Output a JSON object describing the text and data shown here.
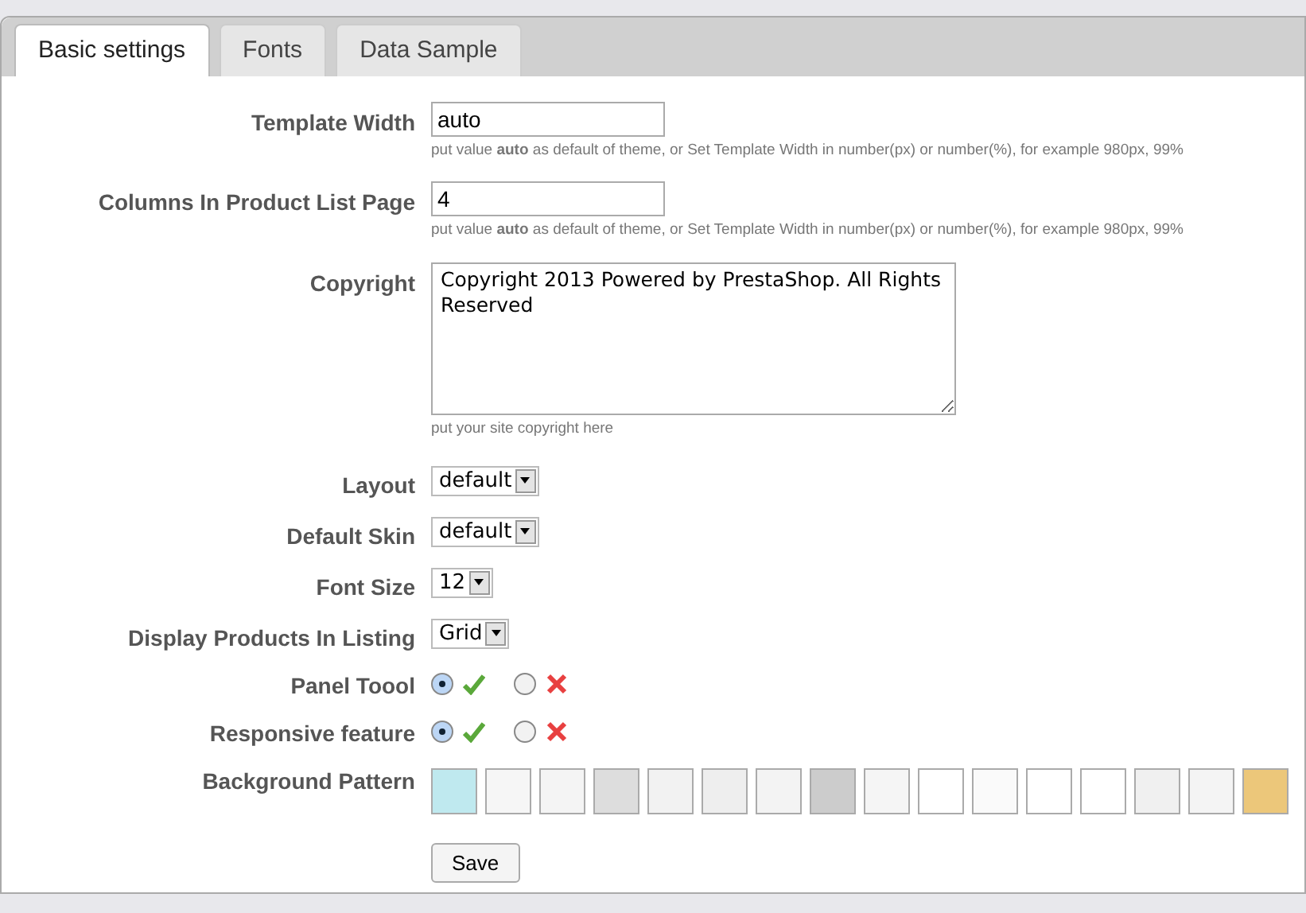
{
  "tabs": [
    {
      "label": "Basic settings",
      "selected": true
    },
    {
      "label": "Fonts",
      "selected": false
    },
    {
      "label": "Data Sample",
      "selected": false
    }
  ],
  "fields": [
    {
      "kind": "text",
      "label": "Template Width",
      "value": "auto",
      "help": "put value **auto** as default of theme, or Set Template Width in number(px) or number(%), for example 980px, 99%"
    },
    {
      "kind": "text",
      "label": "Columns In Product List Page",
      "value": "4",
      "help": "put value **auto** as default of theme, or Set Template Width in number(px) or number(%), for example 980px, 99%"
    },
    {
      "kind": "textarea",
      "label": "Copyright",
      "value": "Copyright 2013 Powered by PrestaShop. All Rights Reserved",
      "help": "put your site copyright here"
    },
    {
      "kind": "select",
      "label": "Layout",
      "value": "default"
    },
    {
      "kind": "select",
      "label": "Default Skin",
      "value": "default"
    },
    {
      "kind": "select",
      "label": "Font Size",
      "value": "12"
    },
    {
      "kind": "select",
      "label": "Display Products In Listing",
      "value": "Grid"
    },
    {
      "kind": "radio",
      "label": "Panel Toool",
      "options": [
        {
          "kind": "yes",
          "selected": true
        },
        {
          "kind": "no",
          "selected": false
        }
      ]
    },
    {
      "kind": "radio",
      "label": "Responsive feature",
      "options": [
        {
          "kind": "yes",
          "selected": true
        },
        {
          "kind": "no",
          "selected": false
        }
      ]
    },
    {
      "kind": "patterns",
      "label": "Background Pattern",
      "patterns": [
        {
          "color": "#bfe9ef"
        },
        {
          "color": "#f6f6f6"
        },
        {
          "color": "#f4f4f4"
        },
        {
          "color": "#dddddd"
        },
        {
          "color": "#f2f2f2"
        },
        {
          "color": "#eeeeee"
        },
        {
          "color": "#f3f3f3"
        },
        {
          "color": "#cccccc"
        },
        {
          "color": "#f5f5f5"
        },
        {
          "color": "#ffffff"
        },
        {
          "color": "#fafafa"
        },
        {
          "color": "#ffffff"
        },
        {
          "color": "#ffffff"
        },
        {
          "color": "#f0f0f0"
        },
        {
          "color": "#f4f4f4"
        },
        {
          "color": "#ecc77a"
        }
      ]
    }
  ],
  "save_button": "Save"
}
